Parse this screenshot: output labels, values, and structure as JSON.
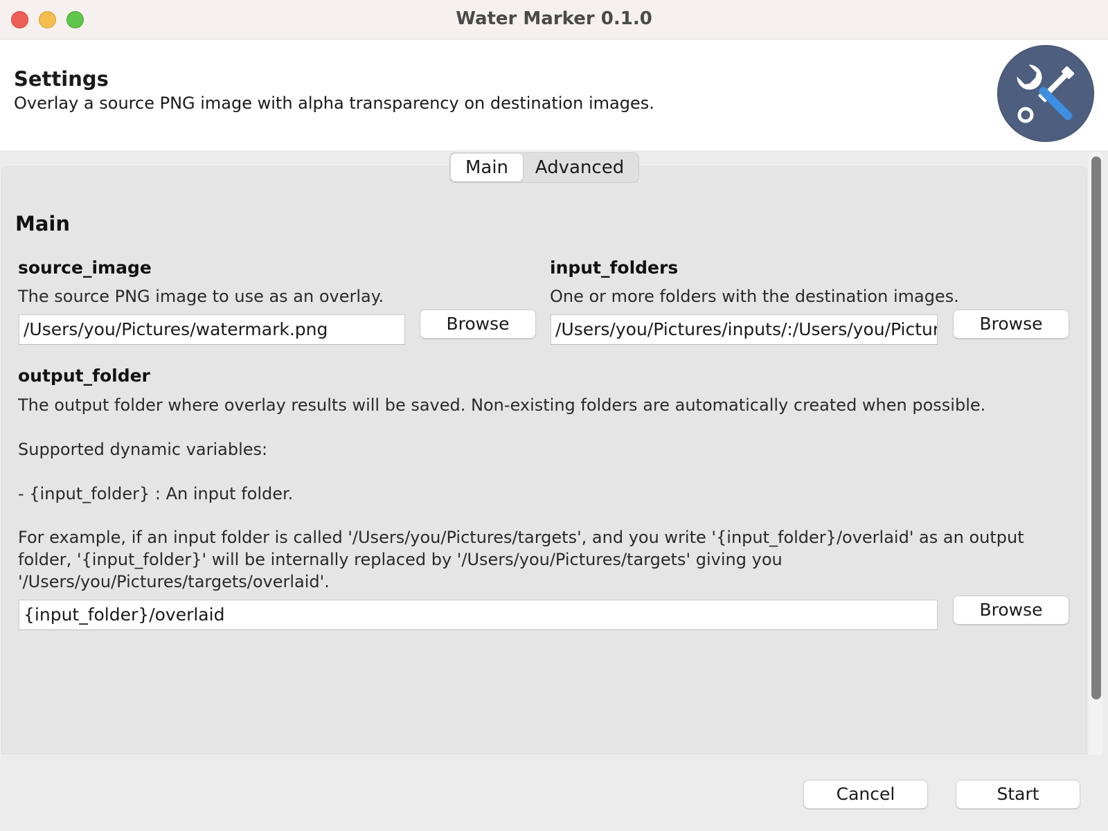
{
  "window": {
    "title": "Water Marker 0.1.0"
  },
  "header": {
    "title": "Settings",
    "description": "Overlay a source PNG image with alpha transparency on destination images.",
    "icon": "tools-icon"
  },
  "tabs": [
    {
      "label": "Main",
      "active": true
    },
    {
      "label": "Advanced",
      "active": false
    }
  ],
  "main": {
    "section_title": "Main",
    "source_image": {
      "label": "source_image",
      "description": "The source PNG image to use as an overlay.",
      "value": "/Users/you/Pictures/watermark.png",
      "browse_label": "Browse"
    },
    "input_folders": {
      "label": "input_folders",
      "description": "One or more folders with the destination images.",
      "value": "/Users/you/Pictures/inputs/:/Users/you/Pictures/",
      "browse_label": "Browse"
    },
    "output_folder": {
      "label": "output_folder",
      "description_line1": "The output folder where overlay results will be saved. Non-existing folders are automatically created when possible.",
      "description_line2": " Supported dynamic variables:",
      "description_line3": " - {input_folder} : An input folder.",
      "description_line4": "For example, if an input folder is called '/Users/you/Pictures/targets', and you write '{input_folder}/overlaid' as an output folder, '{input_folder}' will be internally replaced by '/Users/you/Pictures/targets' giving you '/Users/you/Pictures/targets/overlaid'.",
      "value": "{input_folder}/overlaid",
      "browse_label": "Browse"
    }
  },
  "footer": {
    "cancel_label": "Cancel",
    "start_label": "Start"
  },
  "colors": {
    "header_icon_bg": "#4d5e7f",
    "close": "#ee5f57",
    "minimize": "#f5bd4f",
    "maximize": "#5fc54c"
  }
}
